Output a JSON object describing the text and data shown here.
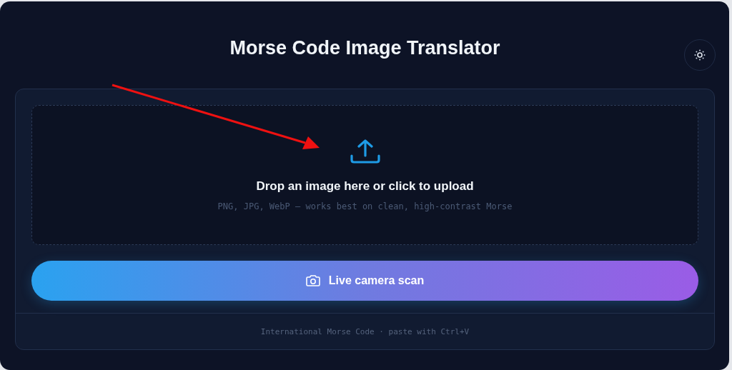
{
  "header": {
    "title": "Morse Code Image Translator"
  },
  "dropzone": {
    "heading": "Drop an image here or click to upload",
    "hint": "PNG, JPG, WebP — works best on clean, high-contrast Morse"
  },
  "camera_button": {
    "label": "Live camera scan"
  },
  "footer": {
    "text": "International Morse Code · paste with Ctrl+V"
  }
}
